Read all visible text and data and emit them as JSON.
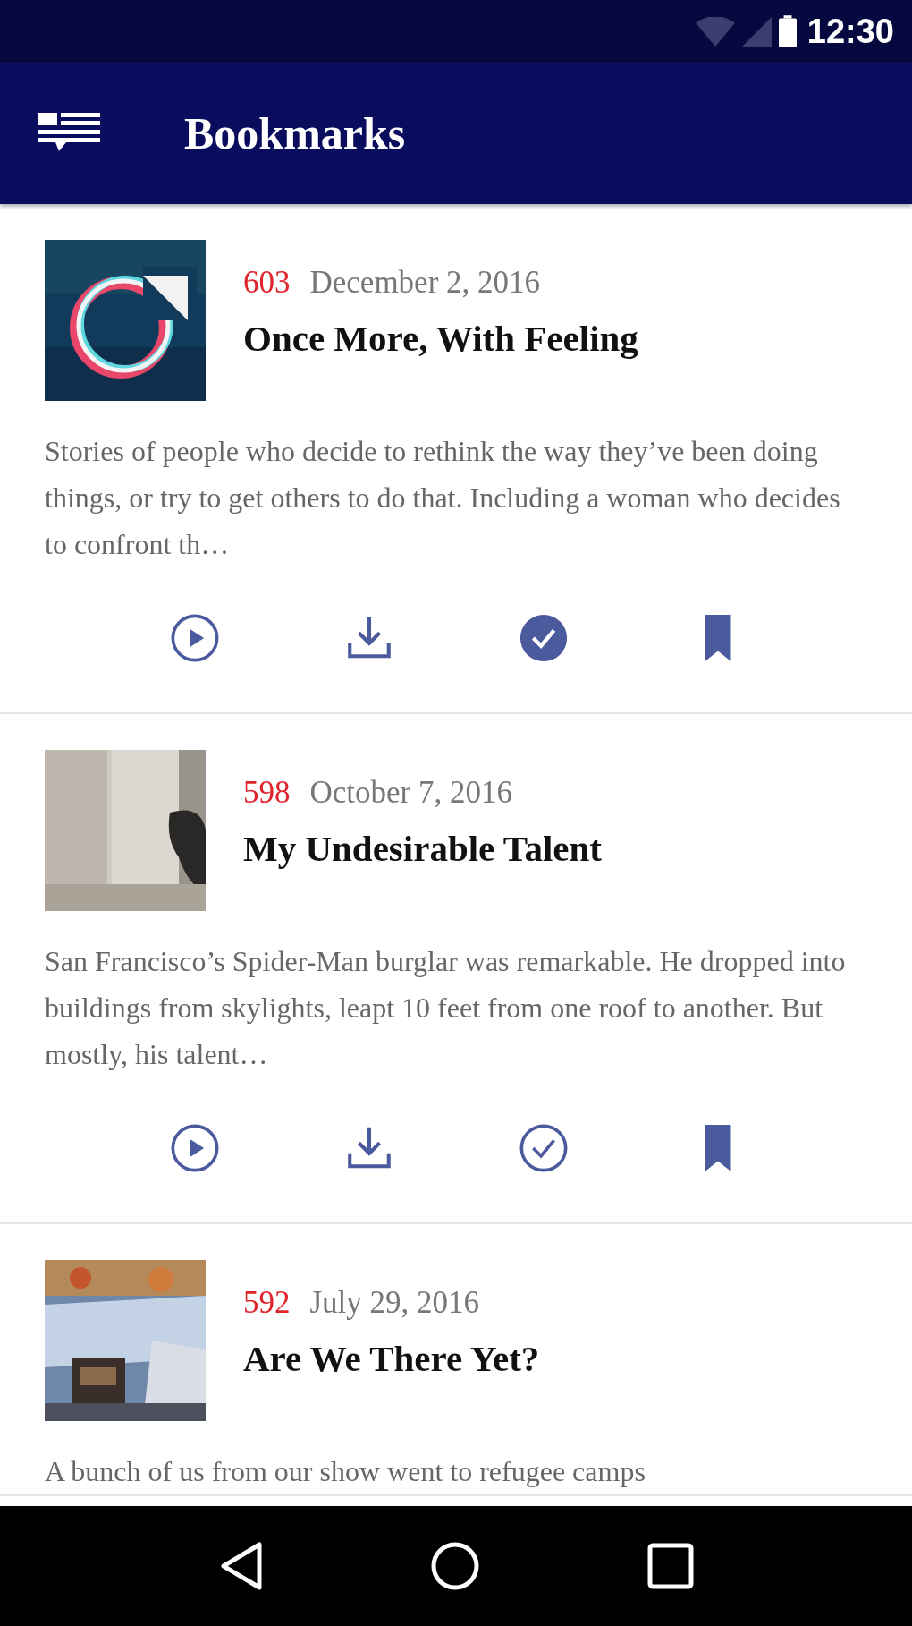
{
  "status_bar": {
    "time": "12:30"
  },
  "app_bar": {
    "title": "Bookmarks"
  },
  "episodes": [
    {
      "number": "603",
      "date": "December 2, 2016",
      "title": "Once More, With Feeling",
      "description": "Stories of people who decide to rethink the way they’ve been doing things, or try to get others to do that. Including a woman who decides to confront th…",
      "played": true,
      "bookmarked": true
    },
    {
      "number": "598",
      "date": "October 7, 2016",
      "title": "My Undesirable Talent",
      "description": "San Francisco’s Spider-Man burglar was remarkable. He dropped into buildings from skylights, leapt 10 feet from one roof to another. But mostly, his talent…",
      "played": false,
      "bookmarked": true
    },
    {
      "number": "592",
      "date": "July 29, 2016",
      "title": "Are We There Yet?",
      "description": "A bunch of us from our show went to refugee camps"
    }
  ]
}
